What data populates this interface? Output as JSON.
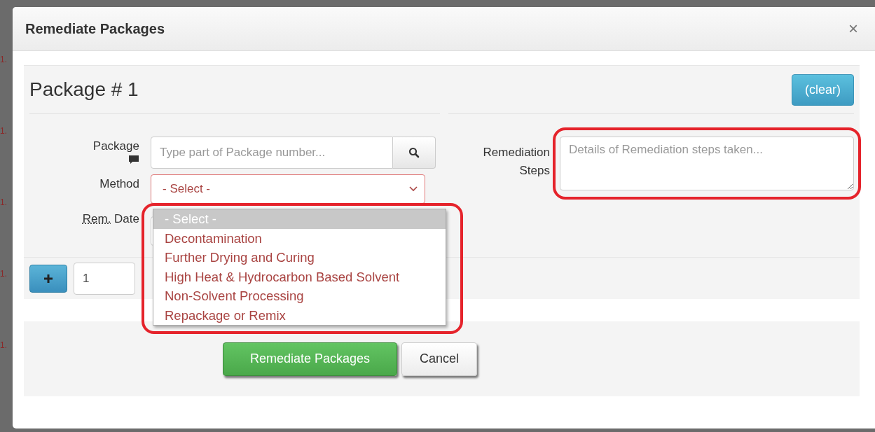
{
  "backdrop": {
    "markers": [
      "1.",
      "1.",
      "1.",
      "1.",
      "1."
    ]
  },
  "window": {
    "title": "Remediate Packages",
    "close": "×"
  },
  "package": {
    "heading": "Package # 1",
    "clear_button": "(clear)",
    "fields": [
      {
        "kind": "search",
        "label": "Package",
        "placeholder": "Type part of Package number...",
        "note_icon": true
      },
      {
        "kind": "select",
        "label": "Method",
        "value": "- Select -",
        "invalid": true
      },
      {
        "kind": "date",
        "label_abbr": "Rem.",
        "label": "Date"
      }
    ],
    "steps": {
      "label": "Remediation Steps",
      "placeholder": "Details of Remediation steps taken...",
      "highlight": true
    }
  },
  "dropdown": {
    "highlight": true,
    "options": [
      {
        "label": "- Select -",
        "selected": true
      },
      {
        "label": "Decontamination",
        "selected": false
      },
      {
        "label": "Further Drying and Curing",
        "selected": false
      },
      {
        "label": "High Heat & Hydrocarbon Based Solvent",
        "selected": false
      },
      {
        "label": "Non-Solvent Processing",
        "selected": false
      },
      {
        "label": "Repackage or Remix",
        "selected": false
      }
    ]
  },
  "add_row": {
    "count": "1"
  },
  "buttons": [
    {
      "kind": "primary",
      "label": "Remediate Packages"
    },
    {
      "kind": "default",
      "label": "Cancel"
    }
  ]
}
